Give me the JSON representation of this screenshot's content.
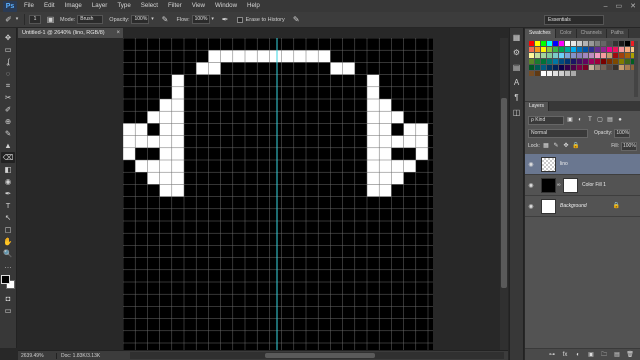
{
  "app": {
    "logo": "Ps"
  },
  "menu": [
    "File",
    "Edit",
    "Image",
    "Layer",
    "Type",
    "Select",
    "Filter",
    "View",
    "Window",
    "Help"
  ],
  "window_controls": [
    "–",
    "▭",
    "✕"
  ],
  "options": {
    "brush_size": "1",
    "mode_label": "Mode:",
    "mode_value": "Brush",
    "opacity_label": "Opacity:",
    "opacity_value": "100%",
    "flow_label": "Flow:",
    "flow_value": "100%",
    "erase_to_history": "Erase to History",
    "workspace": "Essentials"
  },
  "document": {
    "tab_title": "Untitled-1 @ 2640% (lino, RGB/8)",
    "tab_close": "×",
    "zoom": "2639.49%",
    "doc_info": "Doc: 1.83K/3.13K",
    "canvas_bg": "#000000",
    "grid_color": "#6a6a6a",
    "guide_color": "#38d6e0",
    "pixel_color": "#ffffff"
  },
  "panels": {
    "tabs": [
      "Swatches",
      "Color",
      "Channels",
      "Paths"
    ],
    "layers_tab": "Layers",
    "filter_kind": "ρ Kind",
    "blend_mode": "Normal",
    "opacity_label": "Opacity:",
    "opacity_value": "100%",
    "lock_label": "Lock:",
    "fill_label": "Fill:",
    "fill_value": "100%",
    "layers": [
      {
        "name": "lino",
        "selected": true,
        "thumb": "checker"
      },
      {
        "name": "Color Fill 1",
        "selected": false,
        "thumb": "black"
      },
      {
        "name": "Background",
        "selected": false,
        "thumb": "white",
        "locked": true
      }
    ]
  },
  "swatch_colors": [
    "#ff0000",
    "#ffff00",
    "#00ff00",
    "#00ffff",
    "#0000ff",
    "#ff00ff",
    "#ffffff",
    "#e6e6e6",
    "#cccccc",
    "#b3b3b3",
    "#999999",
    "#808080",
    "#666666",
    "#4d4d4d",
    "#333333",
    "#1a1a1a",
    "#000000",
    "#ed1c24",
    "#f26c4f",
    "#f7941d",
    "#fff200",
    "#8dc63f",
    "#39b54a",
    "#00a651",
    "#00a99d",
    "#00aeef",
    "#0072bc",
    "#0054a6",
    "#2e3192",
    "#662d91",
    "#92278f",
    "#ec008c",
    "#ed145b",
    "#f5989d",
    "#f9ad81",
    "#fdc68a",
    "#fff79a",
    "#c4df9b",
    "#a3d39c",
    "#82ca9c",
    "#7accc8",
    "#6dcff6",
    "#7da7d9",
    "#8393ca",
    "#8781bd",
    "#a186be",
    "#bd8cbf",
    "#f49ac2",
    "#f6989d",
    "#c69c6d",
    "#9e0b0f",
    "#a0410d",
    "#a3620a",
    "#aba000",
    "#598527",
    "#1a7b30",
    "#007236",
    "#00746b",
    "#0076a3",
    "#004b80",
    "#003471",
    "#1b1464",
    "#440e62",
    "#630460",
    "#9e005d",
    "#9e0039",
    "#790000",
    "#7b2e00",
    "#7d4900",
    "#827b00",
    "#406618",
    "#005e20",
    "#005826",
    "#005952",
    "#005b7f",
    "#003663",
    "#002157",
    "#0d004c",
    "#32004b",
    "#4b0049",
    "#7b0046",
    "#7a0026",
    "#c7b299",
    "#998675",
    "#736357",
    "#534741",
    "#37302a",
    "#c69c6d",
    "#a67c52",
    "#8c6239",
    "#754c24",
    "#603913",
    "#ffffff",
    "#f2f2f2",
    "#e0e0e0",
    "#cfcfcf",
    "#bdbdbd",
    "#ababab"
  ],
  "tools": [
    "✥",
    "▭",
    "ʆ",
    "◌",
    "⌗",
    "✂",
    "✐",
    "⊕",
    "✎",
    "▲",
    "⌫",
    "◧",
    "◉",
    "✒",
    "T",
    "↖",
    "▢",
    "✋",
    "🔍",
    "…"
  ],
  "dock_icons": [
    "▦",
    "⚙",
    "▤",
    "A",
    "¶",
    "◫"
  ],
  "footer_icons": [
    "⊶",
    "fx",
    "◐",
    "▣",
    "🗀",
    "▤",
    "🗑"
  ]
}
